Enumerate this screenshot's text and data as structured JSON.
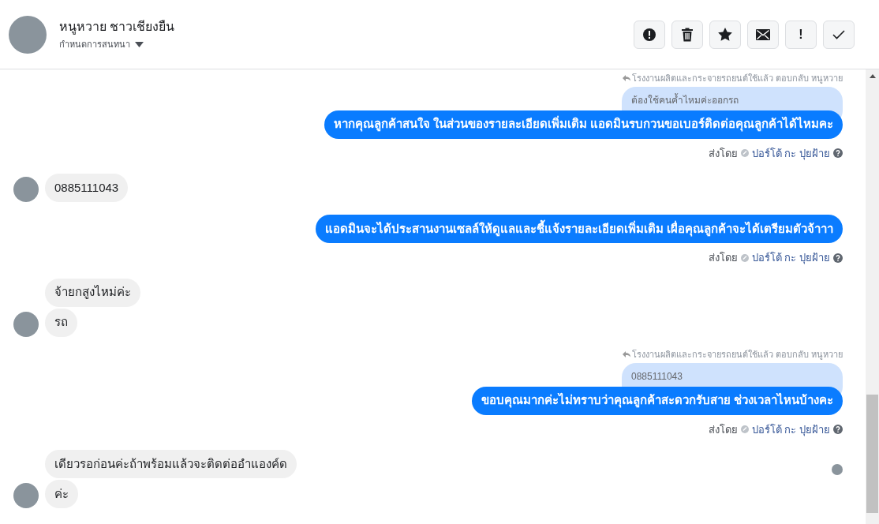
{
  "header": {
    "name": "หนูหวาย ชาวเชียงยืน",
    "subtitle": "กำหนดการสนทนา",
    "actions": [
      {
        "kind": "alert"
      },
      {
        "kind": "trash"
      },
      {
        "kind": "star"
      },
      {
        "kind": "mail"
      },
      {
        "kind": "important",
        "label": "!"
      },
      {
        "kind": "done"
      }
    ]
  },
  "messages": [
    {
      "kind": "outgoing",
      "reply_note": "โรงงานผลิตและกระจายรถยนต์ใช้แล้ว ตอบกลับ หนูหวาย",
      "quoted": "ต้องใช้คนค้ำไหมค่ะออกรถ",
      "text": "หากคุณลูกค้าสนใจ ในส่วนของรายละเอียดเพิ่มเติม แอดมินรบกวนขอเบอร์ติดต่อคุณลูกค้าได้ไหมคะ",
      "sent_prefix": "ส่งโดย",
      "sender": "ปอร์โต้ กะ ปุยฝ้าย"
    },
    {
      "kind": "incoming",
      "lines": [
        "0885111043"
      ]
    },
    {
      "kind": "outgoing",
      "text": "แอดมินจะได้ประสานงานเซลล์ให้ดูแลและชี้แจ้งรายละเอียดเพิ่มเติม เผื่อคุณลูกค้าจะได้เตรียมตัวจ้าาา",
      "sent_prefix": "ส่งโดย",
      "sender": "ปอร์โต้ กะ ปุยฝ้าย"
    },
    {
      "kind": "incoming",
      "lines": [
        "จ้ายกสูงไหม่ค่ะ",
        "รถ"
      ]
    },
    {
      "kind": "outgoing",
      "reply_note": "โรงงานผลิตและกระจายรถยนต์ใช้แล้ว ตอบกลับ หนูหวาย",
      "quoted": "0885111043",
      "text": "ขอบคุณมากค่ะไม่ทราบว่าคุณลูกค้าสะดวกรับสาย ช่วงเวลาไหนบ้างคะ",
      "sent_prefix": "ส่งโดย",
      "sender": "ปอร์โต้ กะ ปุยฝ้าย"
    },
    {
      "kind": "incoming",
      "lines": [
        "เดียวรอก่อนค่ะถ้าพร้อมแล้วจะติดต่ออำแองค์ด",
        "ค่ะ"
      ],
      "seen": true
    }
  ]
}
